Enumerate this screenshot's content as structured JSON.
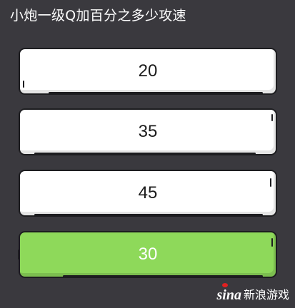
{
  "question": "小炮一级Q加百分之多少攻速",
  "options": [
    {
      "label": "20",
      "state": "default"
    },
    {
      "label": "35",
      "state": "default"
    },
    {
      "label": "45",
      "state": "default"
    },
    {
      "label": "30",
      "state": "correct"
    }
  ],
  "watermark": {
    "logo": "sina",
    "text": "新浪游戏"
  },
  "colors": {
    "background": "#3a393e",
    "option_default": "#ffffff",
    "option_correct": "#8ed95a",
    "outline": "#1d1d20"
  }
}
